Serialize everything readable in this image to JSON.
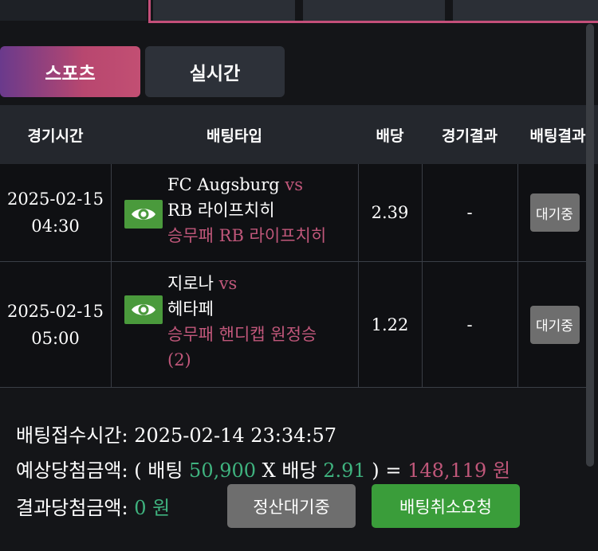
{
  "segments": {
    "sports": "스포츠",
    "live": "실시간"
  },
  "table": {
    "headers": [
      "경기시간",
      "배팅타입",
      "배당",
      "경기결과",
      "배팅결과"
    ],
    "rows": [
      {
        "date": "2025-02-15",
        "time": "04:30",
        "home": "FC Augsburg",
        "vs": "vs",
        "away": "RB 라이프치히",
        "pick_line1": "승무패 RB 라이프치히",
        "pick_line2": "",
        "odds": "2.39",
        "match_result": "-",
        "bet_result": "대기중"
      },
      {
        "date": "2025-02-15",
        "time": "05:00",
        "home": "지로나",
        "vs": "vs",
        "away": "헤타페",
        "pick_line1": "승무패 핸디캡 원정승",
        "pick_line2": "(2)",
        "odds": "1.22",
        "match_result": "-",
        "bet_result": "대기중"
      }
    ]
  },
  "summary": {
    "received_label": "배팅접수시간:",
    "received_value": "2025-02-14 23:34:57",
    "expected_label": "예상당첨금액:",
    "open_paren": "(",
    "bet_label": "배팅",
    "bet_amount": "50,900",
    "x": "X",
    "odds_label": "배당",
    "total_odds": "2.91",
    "close_paren": ")",
    "equals": "=",
    "expected_amount": "148,119 원",
    "result_label": "결과당첨금액:",
    "result_amount": "0 원"
  },
  "buttons": {
    "settlement_wait": "정산대기중",
    "cancel_bet": "배팅취소요청"
  },
  "colors": {
    "accent_pink": "#c0577a",
    "green_amount": "#3fb37f",
    "cancel_button": "#3a9d3a",
    "eye_button": "#4a9a3c"
  }
}
